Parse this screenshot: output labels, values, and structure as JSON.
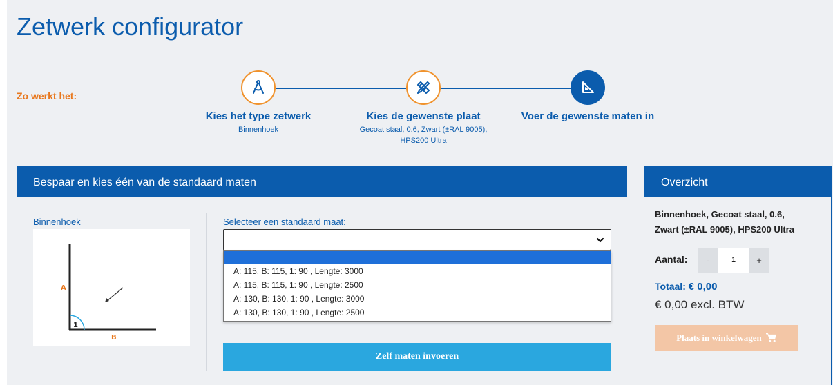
{
  "page": {
    "title": "Zetwerk configurator",
    "how_label": "Zo werkt het:"
  },
  "steps": [
    {
      "title": "Kies het type zetwerk",
      "subtitle": "Binnenhoek",
      "icon": "compass-icon"
    },
    {
      "title": "Kies de gewenste plaat",
      "subtitle_line1": "Gecoat staal, 0.6, Zwart (±RAL 9005),",
      "subtitle_line2": "HPS200 Ultra",
      "icon": "ruler-pencil-icon"
    },
    {
      "title": "Voer de gewenste maten in",
      "icon": "set-square-icon"
    }
  ],
  "panel": {
    "header": "Bespaar en kies één van de standaard maten",
    "shape_label": "Binnenhoek",
    "diagram": {
      "label_a": "A",
      "label_b": "B",
      "label_angle": "1"
    },
    "select_label": "Selecteer een standaard maat:",
    "select_value": "",
    "options": [
      "",
      "A: 115, B: 115, 1: 90 , Lengte: 3000",
      "A: 115, B: 115, 1: 90 , Lengte: 2500",
      "A: 130, B: 130, 1: 90 , Lengte: 3000",
      "A: 130, B: 130, 1: 90 , Lengte: 2500"
    ],
    "own_button": "Zelf maten invoeren"
  },
  "overview": {
    "header": "Overzicht",
    "product_line1": "Binnenhoek, Gecoat staal, 0.6,",
    "product_line2": "Zwart (±RAL 9005), HPS200 Ultra",
    "qty_label": "Aantal:",
    "minus": "-",
    "plus": "+",
    "qty": "1",
    "total_label": "Totaal:",
    "total_value": "€ 0,00",
    "excl": "€ 0,00 excl. BTW",
    "cart_button": "Plaats in winkelwagen"
  },
  "colors": {
    "brand": "#0b5cad",
    "accent": "#f0922c",
    "button": "#2aa7df",
    "cart": "#f3c6a6"
  }
}
